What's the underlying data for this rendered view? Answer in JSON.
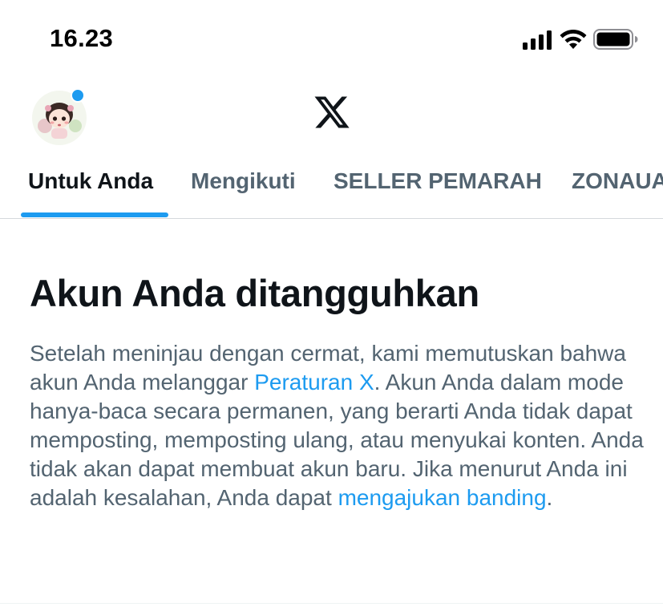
{
  "status_bar": {
    "time": "16.23",
    "icons": [
      "signal-icon",
      "wifi-icon",
      "battery-icon"
    ]
  },
  "header": {
    "avatar_icon": "avatar",
    "logo_icon": "x-logo-icon",
    "notification_dot_color": "#1d9bf0"
  },
  "tabs": [
    {
      "label": "Untuk Anda",
      "active": true
    },
    {
      "label": "Mengikuti",
      "active": false
    },
    {
      "label": "SELLER PEMARAH",
      "active": false
    },
    {
      "label": "ZONAUANG",
      "active": false
    }
  ],
  "notice": {
    "title": "Akun Anda ditangguhkan",
    "body_part1": "Setelah meninjau dengan cermat, kami memutuskan bahwa akun Anda melanggar ",
    "rules_link": "Peraturan X",
    "body_part2": ". Akun Anda dalam mode hanya-baca secara permanen, yang berarti Anda tidak dapat memposting, memposting ulang, atau menyukai konten. Anda tidak akan dapat membuat akun baru. Jika menurut Anda ini adalah kesalahan, Anda dapat ",
    "appeal_link": "mengajukan banding",
    "body_part3": "."
  },
  "colors": {
    "accent": "#1d9bf0",
    "text_primary": "#0f1419",
    "text_secondary": "#536471"
  }
}
